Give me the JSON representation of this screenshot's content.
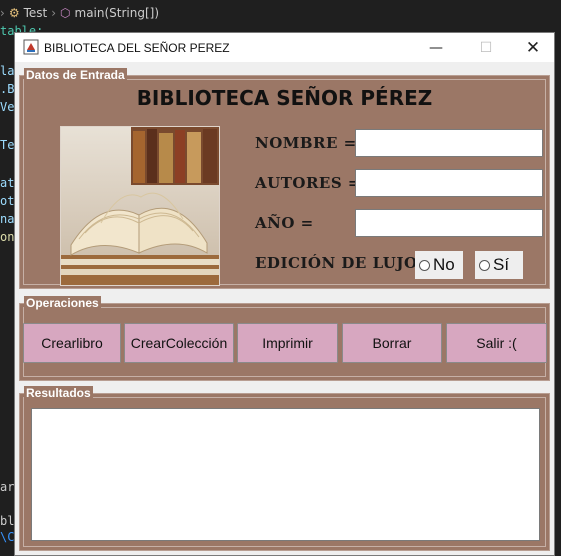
{
  "ide": {
    "breadcrumb": [
      "Test",
      "main(String[])"
    ],
    "left_code_fragments": [
      "table;",
      "la",
      ".B",
      "Ve",
      "Te",
      "at",
      "ot",
      "na",
      "on",
      "ar",
      "bl",
      "\\C"
    ]
  },
  "window": {
    "title": "BIBLIOTECA DEL SEÑOR PEREZ",
    "controls": {
      "minimize": "—",
      "maximize": "☐",
      "close": "✕"
    }
  },
  "datos": {
    "legend": "Datos de Entrada",
    "heading": "BIBLIOTECA SEÑOR PÉREZ",
    "nombre_label": "NOMBRE =",
    "nombre_value": "",
    "autores_label": "AUTORES =",
    "autores_value": "",
    "anio_label": "AÑO =",
    "anio_value": "",
    "edicion_label": "EDICIÓN DE LUJO =",
    "radio_no": "No",
    "radio_si": "Sí"
  },
  "operaciones": {
    "legend": "Operaciones",
    "buttons": [
      "Crearlibro",
      "CrearColección",
      "Imprimir",
      "Borrar",
      "Salir :("
    ]
  },
  "resultados": {
    "legend": "Resultados",
    "text": ""
  },
  "colors": {
    "panel_bg": "#9b7766",
    "button_bg": "#d7a7c0"
  }
}
